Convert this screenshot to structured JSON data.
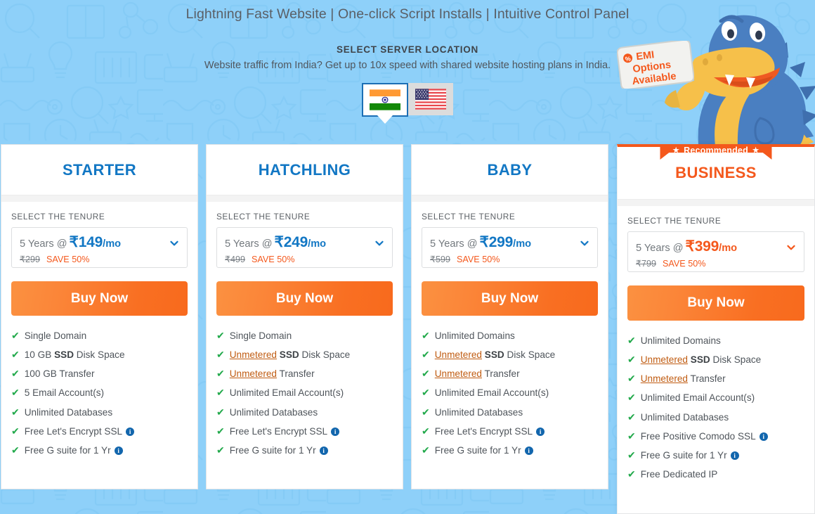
{
  "header": {
    "tagline": "Lightning Fast Website | One-click Script Installs | Intuitive Control Panel",
    "location_title": "SELECT SERVER LOCATION",
    "location_subtitle": "Website traffic from India? Get up to 10x speed with shared website hosting plans in India.",
    "flags": [
      {
        "name": "india-flag",
        "label": "India",
        "selected": true
      },
      {
        "name": "usa-flag",
        "label": "United States",
        "selected": false
      }
    ]
  },
  "mascot": {
    "name": "hostgator-alligator-mascot",
    "badge_icon": "percent-icon",
    "badge_line1": "EMI",
    "badge_line2": "Options",
    "badge_line3": "Available"
  },
  "colors": {
    "background": "#8ED0F9",
    "accent_blue": "#1277c4",
    "accent_orange": "#f4581c",
    "check_green": "#22a94b",
    "info_blue": "#1266ad"
  },
  "common": {
    "tenure_label": "SELECT THE TENURE",
    "buy_label": "Buy Now",
    "save_label": "SAVE 50%",
    "recommended_label": "Recommended",
    "chevron_icon": "chevron-down-icon",
    "check_icon": "check-icon",
    "info_icon": "info-icon",
    "star_icon": "star-icon"
  },
  "plans": [
    {
      "name": "STARTER",
      "featured": false,
      "recommended": false,
      "tenure_years": "5 Years",
      "at": "@",
      "price": "₹149",
      "per": "/mo",
      "old_price": "₹299",
      "save": "SAVE 50%",
      "buy_label": "Buy Now",
      "features": [
        {
          "pre": "",
          "strong": "",
          "mid": "",
          "bold": "",
          "post": "Single Domain",
          "info": false
        },
        {
          "pre": "10 GB ",
          "strong": "",
          "mid": "",
          "bold": "SSD",
          "post": " Disk Space",
          "info": false
        },
        {
          "pre": "",
          "strong": "",
          "mid": "",
          "bold": "",
          "post": "100 GB Transfer",
          "info": false
        },
        {
          "pre": "",
          "strong": "",
          "mid": "",
          "bold": "",
          "post": "5 Email Account(s)",
          "info": false
        },
        {
          "pre": "",
          "strong": "",
          "mid": "",
          "bold": "",
          "post": "Unlimited Databases",
          "info": false
        },
        {
          "pre": "",
          "strong": "",
          "mid": "",
          "bold": "",
          "post": "Free Let's Encrypt SSL",
          "info": true
        },
        {
          "pre": "",
          "strong": "",
          "mid": "",
          "bold": "",
          "post": "Free G suite for 1 Yr",
          "info": true
        }
      ]
    },
    {
      "name": "HATCHLING",
      "featured": false,
      "recommended": false,
      "tenure_years": "5 Years",
      "at": "@",
      "price": "₹249",
      "per": "/mo",
      "old_price": "₹499",
      "save": "SAVE 50%",
      "buy_label": "Buy Now",
      "features": [
        {
          "pre": "",
          "strong": "",
          "mid": "",
          "bold": "",
          "post": "Single Domain",
          "info": false
        },
        {
          "pre": "",
          "strong": "Unmetered",
          "mid": " ",
          "bold": "SSD",
          "post": " Disk Space",
          "info": false
        },
        {
          "pre": "",
          "strong": "Unmetered",
          "mid": " ",
          "bold": "",
          "post": "Transfer",
          "info": false
        },
        {
          "pre": "",
          "strong": "",
          "mid": "",
          "bold": "",
          "post": "Unlimited Email Account(s)",
          "info": false
        },
        {
          "pre": "",
          "strong": "",
          "mid": "",
          "bold": "",
          "post": "Unlimited Databases",
          "info": false
        },
        {
          "pre": "",
          "strong": "",
          "mid": "",
          "bold": "",
          "post": "Free Let's Encrypt SSL",
          "info": true
        },
        {
          "pre": "",
          "strong": "",
          "mid": "",
          "bold": "",
          "post": "Free G suite for 1 Yr",
          "info": true
        }
      ]
    },
    {
      "name": "BABY",
      "featured": false,
      "recommended": false,
      "tenure_years": "5 Years",
      "at": "@",
      "price": "₹299",
      "per": "/mo",
      "old_price": "₹599",
      "save": "SAVE 50%",
      "buy_label": "Buy Now",
      "features": [
        {
          "pre": "",
          "strong": "",
          "mid": "",
          "bold": "",
          "post": "Unlimited Domains",
          "info": false
        },
        {
          "pre": "",
          "strong": "Unmetered",
          "mid": " ",
          "bold": "SSD",
          "post": " Disk Space",
          "info": false
        },
        {
          "pre": "",
          "strong": "Unmetered",
          "mid": " ",
          "bold": "",
          "post": "Transfer",
          "info": false
        },
        {
          "pre": "",
          "strong": "",
          "mid": "",
          "bold": "",
          "post": "Unlimited Email Account(s)",
          "info": false
        },
        {
          "pre": "",
          "strong": "",
          "mid": "",
          "bold": "",
          "post": "Unlimited Databases",
          "info": false
        },
        {
          "pre": "",
          "strong": "",
          "mid": "",
          "bold": "",
          "post": "Free Let's Encrypt SSL",
          "info": true
        },
        {
          "pre": "",
          "strong": "",
          "mid": "",
          "bold": "",
          "post": "Free G suite for 1 Yr",
          "info": true
        }
      ]
    },
    {
      "name": "BUSINESS",
      "featured": true,
      "recommended": true,
      "recommended_label": "Recommended",
      "tenure_years": "5 Years",
      "at": "@",
      "price": "₹399",
      "per": "/mo",
      "old_price": "₹799",
      "save": "SAVE 50%",
      "buy_label": "Buy Now",
      "features": [
        {
          "pre": "",
          "strong": "",
          "mid": "",
          "bold": "",
          "post": "Unlimited Domains",
          "info": false
        },
        {
          "pre": "",
          "strong": "Unmetered",
          "mid": " ",
          "bold": "SSD",
          "post": " Disk Space",
          "info": false
        },
        {
          "pre": "",
          "strong": "Unmetered",
          "mid": " ",
          "bold": "",
          "post": "Transfer",
          "info": false
        },
        {
          "pre": "",
          "strong": "",
          "mid": "",
          "bold": "",
          "post": "Unlimited Email Account(s)",
          "info": false
        },
        {
          "pre": "",
          "strong": "",
          "mid": "",
          "bold": "",
          "post": "Unlimited Databases",
          "info": false
        },
        {
          "pre": "",
          "strong": "",
          "mid": "",
          "bold": "",
          "post": "Free Positive Comodo SSL",
          "info": true
        },
        {
          "pre": "",
          "strong": "",
          "mid": "",
          "bold": "",
          "post": "Free G suite for 1 Yr",
          "info": true
        },
        {
          "pre": "",
          "strong": "",
          "mid": "",
          "bold": "",
          "post": "Free Dedicated IP",
          "info": false
        }
      ]
    }
  ]
}
